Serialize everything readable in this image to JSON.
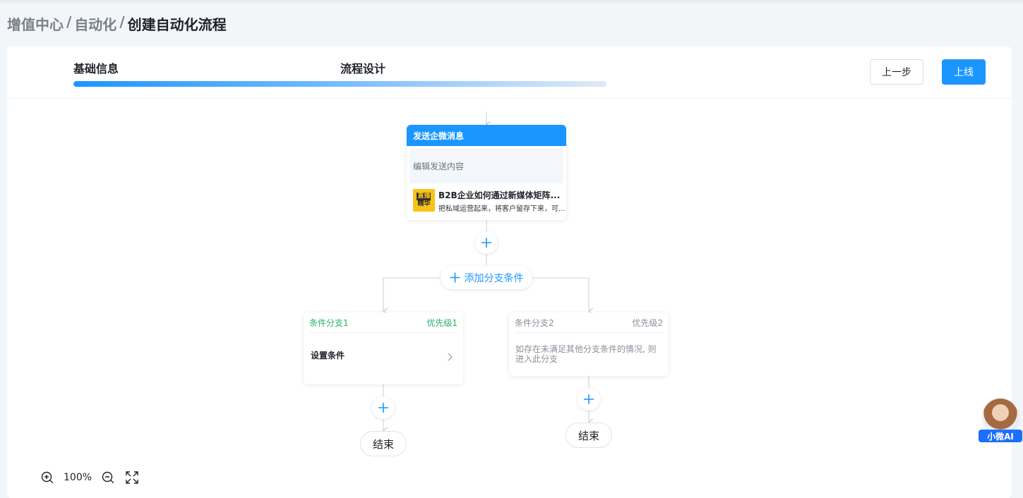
{
  "breadcrumb": {
    "items": [
      "增值中心",
      "自动化"
    ],
    "separator": "/",
    "current": "创建自动化流程"
  },
  "steps": [
    "基础信息",
    "流程设计"
  ],
  "progress_fraction": 1.0,
  "buttons": {
    "prev": "上一步",
    "online": "上线"
  },
  "message_node": {
    "title": "发送企微消息",
    "edit_placeholder": "编辑发送内容",
    "article": {
      "thumb_line1": "直播",
      "thumb_line2": "精华",
      "title": "B2B企业如何通过新媒体矩阵...",
      "desc": "把私域运营起来，将客户留存下来，可..."
    }
  },
  "add_branch_label": "添加分支条件",
  "branches": [
    {
      "name": "条件分支1",
      "priority": "优先级1",
      "body": "设置条件"
    },
    {
      "name": "条件分支2",
      "priority": "优先级2",
      "body": "如存在未满足其他分支条件的情况, 则进入此分支"
    }
  ],
  "end_label": "结束",
  "zoom": {
    "level": "100%"
  },
  "assistant": {
    "label": "小微AI"
  },
  "colors": {
    "accent": "#1b96ff",
    "branch1": "#27b36a",
    "muted": "#8a9099"
  },
  "icons": [
    "plus-icon",
    "zoom-in-icon",
    "zoom-out-icon",
    "fullscreen-icon",
    "chevron-right-icon"
  ]
}
